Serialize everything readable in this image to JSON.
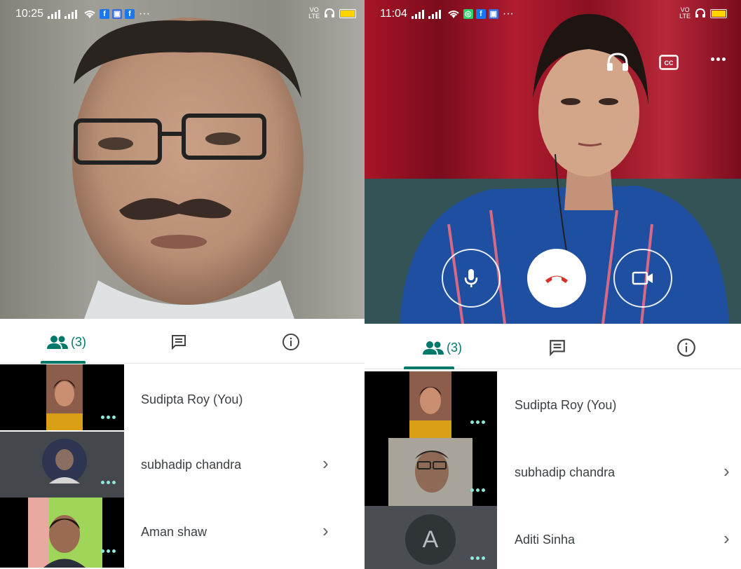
{
  "left": {
    "status": {
      "time": "10:25",
      "lte": [
        "VO",
        "LTE"
      ]
    },
    "tabs": {
      "people_count": "(3)"
    },
    "participants": [
      {
        "name": "Sudipta Roy (You)"
      },
      {
        "name": "subhadip chandra"
      },
      {
        "name": "Aman shaw"
      }
    ]
  },
  "right": {
    "status": {
      "time": "11:04",
      "lte": [
        "VO",
        "LTE"
      ]
    },
    "tabs": {
      "people_count": "(3)"
    },
    "participants": [
      {
        "name": "Sudipta Roy (You)"
      },
      {
        "name": "subhadip chandra"
      },
      {
        "name": "Aditi Sinha",
        "avatar_letter": "A"
      }
    ]
  },
  "colors": {
    "accent": "#00796b",
    "end_call": "#d93025",
    "dots": "#8fe8d8"
  },
  "icons": [
    "people-icon",
    "chat-icon",
    "info-icon",
    "headphones-icon",
    "captions-icon",
    "more-icon",
    "mic-icon",
    "end-call-icon",
    "camera-icon",
    "chevron-right-icon"
  ]
}
